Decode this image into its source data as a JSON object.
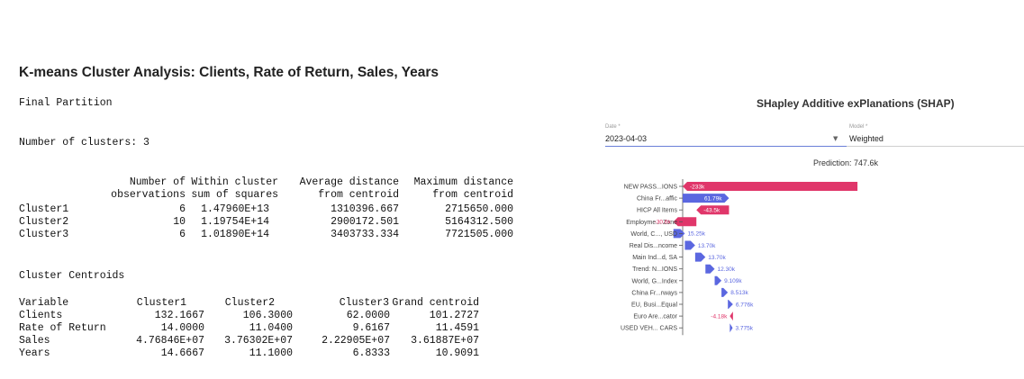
{
  "kmeans": {
    "title": "K-means Cluster Analysis: Clients, Rate of Return, Sales, Years",
    "final_partition": "Final Partition",
    "number_of_clusters": "Number of clusters: 3",
    "partition_header_line1": [
      "Number of",
      "Within cluster",
      "Average distance",
      "Maximum distance"
    ],
    "partition_header_line2": [
      "observations",
      "sum of squares",
      "from centroid",
      "from centroid"
    ],
    "partition_rows": [
      {
        "name": "Cluster1",
        "n": "6",
        "ss": "1.47960E+13",
        "avg": "1310396.667",
        "max": "2715650.000"
      },
      {
        "name": "Cluster2",
        "n": "10",
        "ss": "1.19754E+14",
        "avg": "2900172.501",
        "max": "5164312.500"
      },
      {
        "name": "Cluster3",
        "n": "6",
        "ss": "1.01890E+14",
        "avg": "3403733.334",
        "max": "7721505.000"
      }
    ],
    "centroids_title": "Cluster Centroids",
    "centroid_headers": [
      "Variable",
      "Cluster1",
      "Cluster2",
      "Cluster3",
      "Grand centroid"
    ],
    "centroid_rows": [
      {
        "variable": "Clients",
        "c1": "132.1667",
        "c2": "106.3000",
        "c3": "62.0000",
        "grand": "101.2727"
      },
      {
        "variable": "Rate of Return",
        "c1": "14.0000",
        "c2": "11.0400",
        "c3": "9.6167",
        "grand": "11.4591"
      },
      {
        "variable": "Sales",
        "c1": "4.76846E+07",
        "c2": "3.76302E+07",
        "c3": "2.22905E+07",
        "grand": "3.61887E+07"
      },
      {
        "variable": "Years",
        "c1": "14.6667",
        "c2": "11.1000",
        "c3": "6.8333",
        "grand": "10.9091"
      }
    ]
  },
  "shap": {
    "title": "SHapley Additive exPlanations (SHAP)",
    "date_label": "Date *",
    "date_value": "2023-04-03",
    "model_label": "Model *",
    "model_value": "Weighted",
    "prediction": "Prediction: 747.6k",
    "colors": {
      "positive": "#5b67e0",
      "negative": "#e0366a"
    }
  },
  "chart_data": {
    "type": "bar",
    "orientation": "horizontal",
    "title": "",
    "categories": [
      "NEW PASS...IONS",
      "China Fr...affic",
      "HICP All Items",
      "Employme... Zone",
      "World, C..., USD",
      "Real Dis...ncome",
      "Main Ind...d, SA",
      "Trend: N...IONS",
      "World, G...Index",
      "China Fr...rways",
      "EU, Busi...Equal",
      "Euro Are...cator",
      "USED VEH... CARS"
    ],
    "values": [
      -233,
      61.79,
      -43.5,
      -30.6,
      15.25,
      13.7,
      13.7,
      12.3,
      9.109,
      8.513,
      6.776,
      -4.18,
      3.775
    ],
    "value_labels": [
      "-233k",
      "61.79k",
      "-43.5k",
      "-30.6k",
      "15.25k",
      "13.70k",
      "13.70k",
      "12.30k",
      "9.109k",
      "8.513k",
      "6.776k",
      "-4.18k",
      "3.775k"
    ],
    "units": "k"
  }
}
